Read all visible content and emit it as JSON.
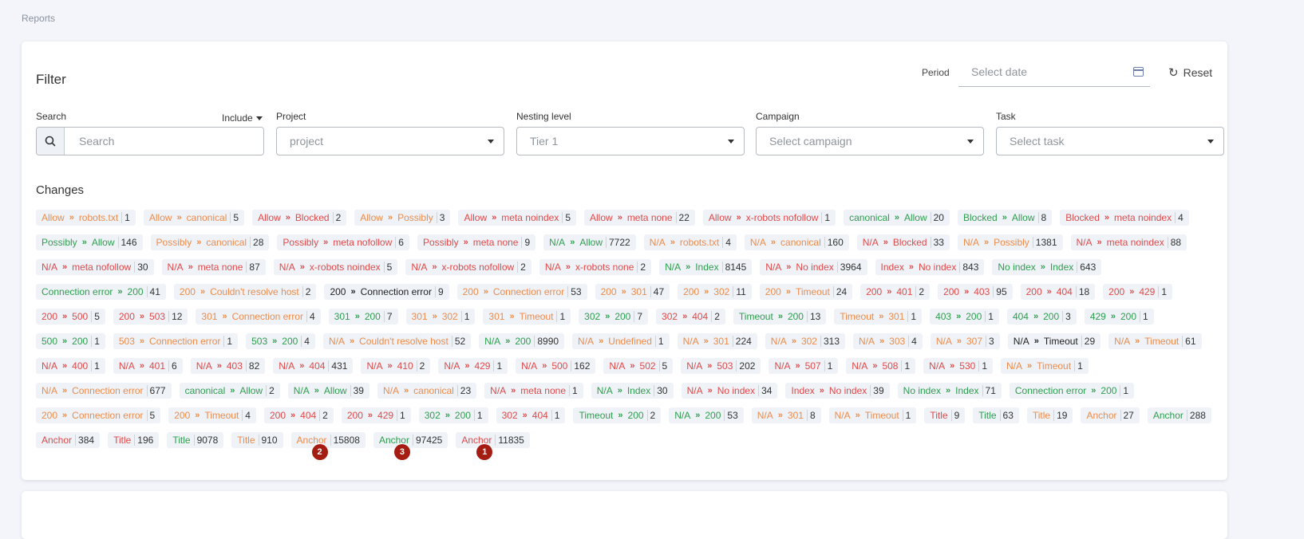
{
  "breadcrumb": "Reports",
  "filter": {
    "title": "Filter",
    "period_label": "Period",
    "date_placeholder": "Select date",
    "reset_label": "Reset",
    "search_label": "Search",
    "include_label": "Include",
    "search_placeholder": "Search",
    "project_label": "Project",
    "project_value": "project",
    "nesting_label": "Nesting level",
    "nesting_value": "Tier 1",
    "campaign_label": "Campaign",
    "campaign_value": "Select campaign",
    "task_label": "Task",
    "task_value": "Select task"
  },
  "changes": {
    "title": "Changes",
    "arrow_glyph": "»",
    "items": [
      {
        "from": "Allow",
        "to": "robots.txt",
        "count": "1",
        "color": "orange"
      },
      {
        "from": "Allow",
        "to": "canonical",
        "count": "5",
        "color": "orange"
      },
      {
        "from": "Allow",
        "to": "Blocked",
        "count": "2",
        "color": "red"
      },
      {
        "from": "Allow",
        "to": "Possibly",
        "count": "3",
        "color": "orange"
      },
      {
        "from": "Allow",
        "to": "meta noindex",
        "count": "5",
        "color": "red"
      },
      {
        "from": "Allow",
        "to": "meta none",
        "count": "22",
        "color": "red"
      },
      {
        "from": "Allow",
        "to": "x-robots nofollow",
        "count": "1",
        "color": "red"
      },
      {
        "from": "canonical",
        "to": "Allow",
        "count": "20",
        "color": "green"
      },
      {
        "from": "Blocked",
        "to": "Allow",
        "count": "8",
        "color": "green"
      },
      {
        "from": "Blocked",
        "to": "meta noindex",
        "count": "4",
        "color": "red"
      },
      {
        "from": "Possibly",
        "to": "Allow",
        "count": "146",
        "color": "green"
      },
      {
        "from": "Possibly",
        "to": "canonical",
        "count": "28",
        "color": "orange"
      },
      {
        "from": "Possibly",
        "to": "meta nofollow",
        "count": "6",
        "color": "red"
      },
      {
        "from": "Possibly",
        "to": "meta none",
        "count": "9",
        "color": "red"
      },
      {
        "from": "N/A",
        "to": "Allow",
        "count": "7722",
        "color": "green"
      },
      {
        "from": "N/A",
        "to": "robots.txt",
        "count": "4",
        "color": "orange"
      },
      {
        "from": "N/A",
        "to": "canonical",
        "count": "160",
        "color": "orange"
      },
      {
        "from": "N/A",
        "to": "Blocked",
        "count": "33",
        "color": "red"
      },
      {
        "from": "N/A",
        "to": "Possibly",
        "count": "1381",
        "color": "orange"
      },
      {
        "from": "N/A",
        "to": "meta noindex",
        "count": "88",
        "color": "red"
      },
      {
        "from": "N/A",
        "to": "meta nofollow",
        "count": "30",
        "color": "red"
      },
      {
        "from": "N/A",
        "to": "meta none",
        "count": "87",
        "color": "red"
      },
      {
        "from": "N/A",
        "to": "x-robots noindex",
        "count": "5",
        "color": "red"
      },
      {
        "from": "N/A",
        "to": "x-robots nofollow",
        "count": "2",
        "color": "red"
      },
      {
        "from": "N/A",
        "to": "x-robots none",
        "count": "2",
        "color": "red"
      },
      {
        "from": "N/A",
        "to": "Index",
        "count": "8145",
        "color": "green"
      },
      {
        "from": "N/A",
        "to": "No index",
        "count": "3964",
        "color": "red"
      },
      {
        "from": "Index",
        "to": "No index",
        "count": "843",
        "color": "red"
      },
      {
        "from": "No index",
        "to": "Index",
        "count": "643",
        "color": "green"
      },
      {
        "from": "Connection error",
        "to": "200",
        "count": "41",
        "color": "green"
      },
      {
        "from": "200",
        "to": "Couldn't resolve host",
        "count": "2",
        "color": "orange"
      },
      {
        "from": "200",
        "to": "Connection error",
        "count": "9",
        "color": "black"
      },
      {
        "from": "200",
        "to": "Connection error",
        "count": "53",
        "color": "orange"
      },
      {
        "from": "200",
        "to": "301",
        "count": "47",
        "color": "orange"
      },
      {
        "from": "200",
        "to": "302",
        "count": "11",
        "color": "orange"
      },
      {
        "from": "200",
        "to": "Timeout",
        "count": "24",
        "color": "orange"
      },
      {
        "from": "200",
        "to": "401",
        "count": "2",
        "color": "red"
      },
      {
        "from": "200",
        "to": "403",
        "count": "95",
        "color": "red"
      },
      {
        "from": "200",
        "to": "404",
        "count": "18",
        "color": "red"
      },
      {
        "from": "200",
        "to": "429",
        "count": "1",
        "color": "red"
      },
      {
        "from": "200",
        "to": "500",
        "count": "5",
        "color": "red"
      },
      {
        "from": "200",
        "to": "503",
        "count": "12",
        "color": "red"
      },
      {
        "from": "301",
        "to": "Connection error",
        "count": "4",
        "color": "orange"
      },
      {
        "from": "301",
        "to": "200",
        "count": "7",
        "color": "green"
      },
      {
        "from": "301",
        "to": "302",
        "count": "1",
        "color": "orange"
      },
      {
        "from": "301",
        "to": "Timeout",
        "count": "1",
        "color": "orange"
      },
      {
        "from": "302",
        "to": "200",
        "count": "7",
        "color": "green"
      },
      {
        "from": "302",
        "to": "404",
        "count": "2",
        "color": "red"
      },
      {
        "from": "Timeout",
        "to": "200",
        "count": "13",
        "color": "green"
      },
      {
        "from": "Timeout",
        "to": "301",
        "count": "1",
        "color": "orange"
      },
      {
        "from": "403",
        "to": "200",
        "count": "1",
        "color": "green"
      },
      {
        "from": "404",
        "to": "200",
        "count": "3",
        "color": "green"
      },
      {
        "from": "429",
        "to": "200",
        "count": "1",
        "color": "green"
      },
      {
        "from": "500",
        "to": "200",
        "count": "1",
        "color": "green"
      },
      {
        "from": "503",
        "to": "Connection error",
        "count": "1",
        "color": "orange"
      },
      {
        "from": "503",
        "to": "200",
        "count": "4",
        "color": "green"
      },
      {
        "from": "N/A",
        "to": "Couldn't resolve host",
        "count": "52",
        "color": "orange"
      },
      {
        "from": "N/A",
        "to": "200",
        "count": "8990",
        "color": "green"
      },
      {
        "from": "N/A",
        "to": "Undefined",
        "count": "1",
        "color": "orange"
      },
      {
        "from": "N/A",
        "to": "301",
        "count": "224",
        "color": "orange"
      },
      {
        "from": "N/A",
        "to": "302",
        "count": "313",
        "color": "orange"
      },
      {
        "from": "N/A",
        "to": "303",
        "count": "4",
        "color": "orange"
      },
      {
        "from": "N/A",
        "to": "307",
        "count": "3",
        "color": "orange"
      },
      {
        "from": "N/A",
        "to": "Timeout",
        "count": "29",
        "color": "black"
      },
      {
        "from": "N/A",
        "to": "Timeout",
        "count": "61",
        "color": "orange"
      },
      {
        "from": "N/A",
        "to": "400",
        "count": "1",
        "color": "red"
      },
      {
        "from": "N/A",
        "to": "401",
        "count": "6",
        "color": "red"
      },
      {
        "from": "N/A",
        "to": "403",
        "count": "82",
        "color": "red"
      },
      {
        "from": "N/A",
        "to": "404",
        "count": "431",
        "color": "red"
      },
      {
        "from": "N/A",
        "to": "410",
        "count": "2",
        "color": "red"
      },
      {
        "from": "N/A",
        "to": "429",
        "count": "1",
        "color": "red"
      },
      {
        "from": "N/A",
        "to": "500",
        "count": "162",
        "color": "red"
      },
      {
        "from": "N/A",
        "to": "502",
        "count": "5",
        "color": "red"
      },
      {
        "from": "N/A",
        "to": "503",
        "count": "202",
        "color": "red"
      },
      {
        "from": "N/A",
        "to": "507",
        "count": "1",
        "color": "red"
      },
      {
        "from": "N/A",
        "to": "508",
        "count": "1",
        "color": "red"
      },
      {
        "from": "N/A",
        "to": "530",
        "count": "1",
        "color": "red"
      },
      {
        "from": "N/A",
        "to": "Timeout",
        "count": "1",
        "color": "orange"
      },
      {
        "from": "N/A",
        "to": "Connection error",
        "count": "677",
        "color": "orange"
      },
      {
        "from": "canonical",
        "to": "Allow",
        "count": "2",
        "color": "green"
      },
      {
        "from": "N/A",
        "to": "Allow",
        "count": "39",
        "color": "green"
      },
      {
        "from": "N/A",
        "to": "canonical",
        "count": "23",
        "color": "orange"
      },
      {
        "from": "N/A",
        "to": "meta none",
        "count": "1",
        "color": "red"
      },
      {
        "from": "N/A",
        "to": "Index",
        "count": "30",
        "color": "green"
      },
      {
        "from": "N/A",
        "to": "No index",
        "count": "34",
        "color": "red"
      },
      {
        "from": "Index",
        "to": "No index",
        "count": "39",
        "color": "red"
      },
      {
        "from": "No index",
        "to": "Index",
        "count": "71",
        "color": "green"
      },
      {
        "from": "Connection error",
        "to": "200",
        "count": "1",
        "color": "green"
      },
      {
        "from": "200",
        "to": "Connection error",
        "count": "5",
        "color": "orange"
      },
      {
        "from": "200",
        "to": "Timeout",
        "count": "4",
        "color": "orange"
      },
      {
        "from": "200",
        "to": "404",
        "count": "2",
        "color": "red"
      },
      {
        "from": "200",
        "to": "429",
        "count": "1",
        "color": "red"
      },
      {
        "from": "302",
        "to": "200",
        "count": "1",
        "color": "green"
      },
      {
        "from": "302",
        "to": "404",
        "count": "1",
        "color": "red"
      },
      {
        "from": "Timeout",
        "to": "200",
        "count": "2",
        "color": "green"
      },
      {
        "from": "N/A",
        "to": "200",
        "count": "53",
        "color": "green"
      },
      {
        "from": "N/A",
        "to": "301",
        "count": "8",
        "color": "orange"
      },
      {
        "from": "N/A",
        "to": "Timeout",
        "count": "1",
        "color": "orange"
      },
      {
        "label": "Title",
        "count": "9",
        "color": "red"
      },
      {
        "label": "Title",
        "count": "63",
        "color": "green"
      },
      {
        "label": "Title",
        "count": "19",
        "color": "orange"
      },
      {
        "label": "Anchor",
        "count": "27",
        "color": "orange"
      },
      {
        "label": "Anchor",
        "count": "288",
        "color": "green"
      },
      {
        "label": "Anchor",
        "count": "384",
        "color": "red"
      },
      {
        "label": "Title",
        "count": "196",
        "color": "red"
      },
      {
        "label": "Title",
        "count": "9078",
        "color": "green"
      },
      {
        "label": "Title",
        "count": "910",
        "color": "orange"
      },
      {
        "label": "Anchor",
        "count": "15808",
        "color": "orange",
        "marker": "2"
      },
      {
        "label": "Anchor",
        "count": "97425",
        "color": "green",
        "marker": "3"
      },
      {
        "label": "Anchor",
        "count": "11835",
        "color": "red",
        "marker": "1"
      }
    ]
  },
  "colors": {
    "orange": "#ed8c4c",
    "red": "#e04a4a",
    "green": "#2f9e4f",
    "black": "#222222",
    "marker": "#a51d12",
    "chip_bg": "#eff2f7",
    "page_bg": "#f3f5fb"
  }
}
